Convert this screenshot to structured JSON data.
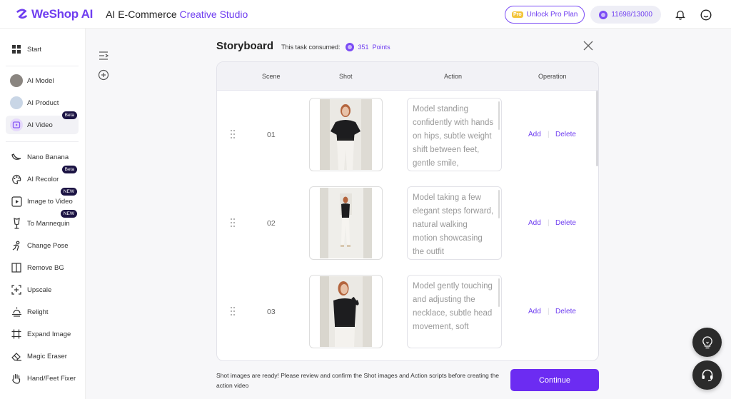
{
  "header": {
    "logo_text": "WeShop AI",
    "title_prefix": "AI E-Commerce ",
    "title_accent": "Creative Studio",
    "pro_badge": "Pro",
    "unlock_label": "Unlock Pro Plan",
    "points_balance": "11698/13000",
    "icons": [
      "bell-icon",
      "avatar-icon"
    ],
    "accent_color": "#6f3ef0"
  },
  "sidebar": {
    "items": [
      {
        "label": "Start",
        "icon": "grid-icon"
      },
      {
        "label": "AI Model",
        "icon": "model-thumb"
      },
      {
        "label": "AI Product",
        "icon": "product-thumb"
      },
      {
        "label": "AI Video",
        "icon": "video-thumb",
        "tag": "Beta",
        "active": true
      },
      {
        "label": "Nano Banana",
        "icon": "banana-icon"
      },
      {
        "label": "AI Recolor",
        "icon": "palette-icon",
        "tag": "Beta"
      },
      {
        "label": "Image to Video",
        "icon": "image-video-icon",
        "tag": "NEW"
      },
      {
        "label": "To Mannequin",
        "icon": "mannequin-icon",
        "tag": "NEW"
      },
      {
        "label": "Change Pose",
        "icon": "pose-icon"
      },
      {
        "label": "Remove BG",
        "icon": "remove-bg-icon"
      },
      {
        "label": "Upscale",
        "icon": "upscale-icon"
      },
      {
        "label": "Relight",
        "icon": "relight-icon"
      },
      {
        "label": "Expand Image",
        "icon": "expand-icon"
      },
      {
        "label": "Magic Eraser",
        "icon": "eraser-icon"
      },
      {
        "label": "Hand/Feet Fixer",
        "icon": "hand-icon"
      }
    ]
  },
  "storyboard": {
    "title": "Storyboard",
    "consumed_label": "This task consumed:",
    "consumed_points": "351",
    "points_label": "Points",
    "columns": [
      "Scene",
      "Shot",
      "Action",
      "Operation"
    ],
    "rows": [
      {
        "scene": "01",
        "action": "Model standing confidently with hands on hips, subtle weight shift between feet, gentle smile,",
        "add": "Add",
        "delete": "Delete"
      },
      {
        "scene": "02",
        "action": "Model taking a few elegant steps forward, natural walking motion showcasing the outfit",
        "add": "Add",
        "delete": "Delete"
      },
      {
        "scene": "03",
        "action": "Model gently touching and adjusting the necklace, subtle head movement, soft",
        "add": "Add",
        "delete": "Delete"
      }
    ],
    "footer_message": "Shot images are ready! Please review and confirm the Shot images and Action scripts before creating the action video",
    "continue_label": "Continue"
  }
}
